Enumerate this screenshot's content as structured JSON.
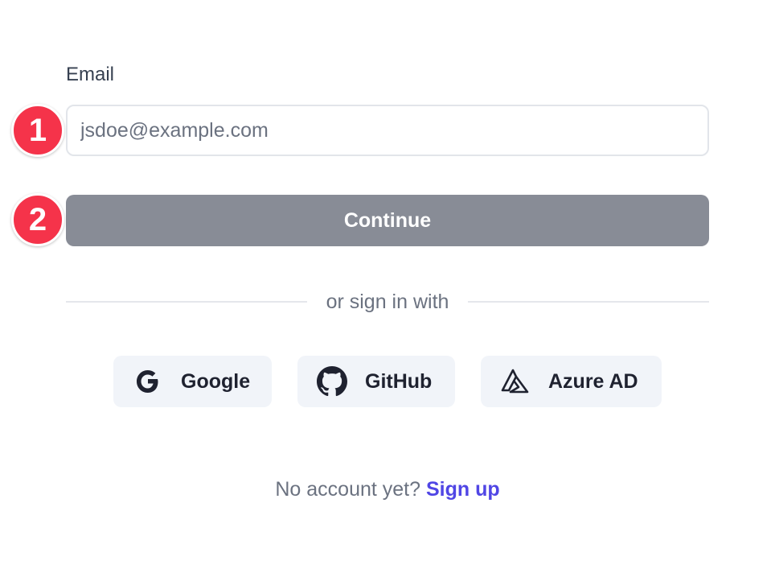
{
  "form": {
    "email_label": "Email",
    "email_placeholder": "jsdoe@example.com",
    "email_value": "",
    "continue_label": "Continue"
  },
  "annotations": {
    "badge_1": "1",
    "badge_2": "2",
    "badge_color": "#f5334a"
  },
  "divider": {
    "text": "or sign in with"
  },
  "providers": [
    {
      "label": "Google",
      "icon": "google-icon"
    },
    {
      "label": "GitHub",
      "icon": "github-icon"
    },
    {
      "label": "Azure AD",
      "icon": "azure-ad-icon"
    }
  ],
  "signup": {
    "prompt": "No account yet?",
    "link_label": "Sign up",
    "link_color": "#5046e5"
  }
}
